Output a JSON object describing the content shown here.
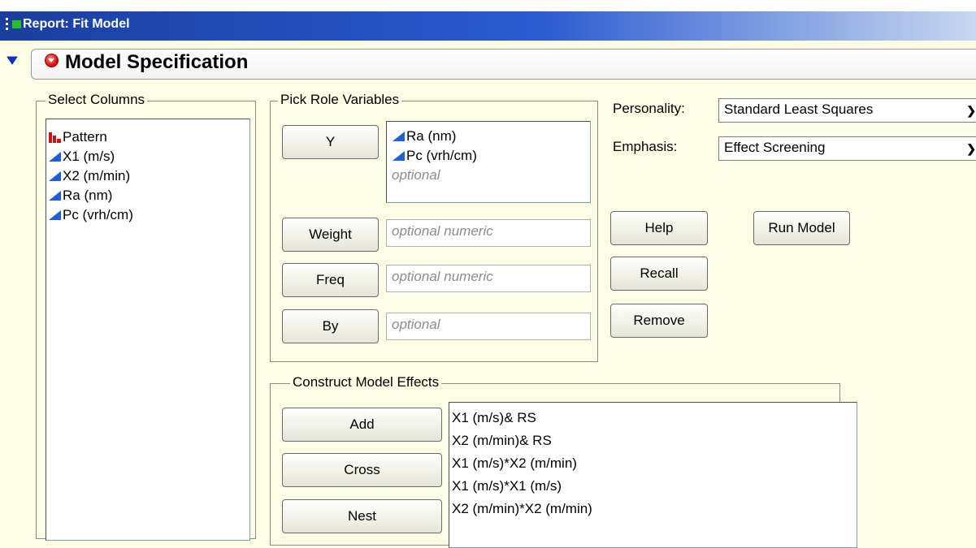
{
  "window": {
    "title": "Report: Fit Model"
  },
  "outline": {
    "title": "Model Specification"
  },
  "select_columns": {
    "label": "Select Columns",
    "items": [
      {
        "name": "Pattern",
        "icon": "nominal-bar-icon"
      },
      {
        "name": "X1 (m/s)",
        "icon": "continuous-triangle-icon"
      },
      {
        "name": "X2 (m/min)",
        "icon": "continuous-triangle-icon"
      },
      {
        "name": "Ra (nm)",
        "icon": "continuous-triangle-icon"
      },
      {
        "name": "Pc (vrh/cm)",
        "icon": "continuous-triangle-icon"
      }
    ]
  },
  "pick_roles": {
    "label": "Pick Role Variables",
    "y": {
      "button": "Y",
      "items": [
        "Ra (nm)",
        "Pc (vrh/cm)"
      ],
      "placeholder": "optional"
    },
    "weight": {
      "button": "Weight",
      "placeholder": "optional numeric"
    },
    "freq": {
      "button": "Freq",
      "placeholder": "optional numeric"
    },
    "by": {
      "button": "By",
      "placeholder": "optional"
    }
  },
  "options": {
    "personality_label": "Personality:",
    "personality_value": "Standard Least Squares",
    "emphasis_label": "Emphasis:",
    "emphasis_value": "Effect Screening"
  },
  "actions": {
    "help": "Help",
    "run_model": "Run Model",
    "recall": "Recall",
    "remove": "Remove"
  },
  "construct_effects": {
    "label": "Construct Model Effects",
    "add": "Add",
    "cross": "Cross",
    "nest": "Nest",
    "effects": [
      "X1 (m/s)& RS",
      "X2 (m/min)& RS",
      "X1 (m/s)*X2 (m/min)",
      "X1 (m/s)*X1 (m/s)",
      "X2 (m/min)*X2 (m/min)"
    ]
  },
  "colors": {
    "background": "#fdfde6",
    "titlebar": "#1a3fa0",
    "continuous_icon": "#1f5fd6",
    "nominal_icon": "#d01010"
  }
}
